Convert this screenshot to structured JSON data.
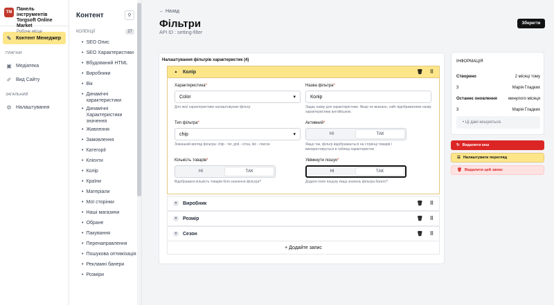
{
  "brand": {
    "logo_text": "TM",
    "title_line1": "Панель інструментів",
    "title_line2": "Torgsoft Online Market",
    "subtitle": "Робоче місце"
  },
  "nav": {
    "items": [
      {
        "label": "Контент Менеджер",
        "icon": "pencil-icon"
      }
    ],
    "plugins_title": "ПЛАГІНИ",
    "plugins": [
      {
        "label": "Медіатека",
        "icon": "image-icon"
      },
      {
        "label": "Вид Сайту",
        "icon": "brush-icon"
      }
    ],
    "general_title": "ЗАГАЛЬНИЙ",
    "general": [
      {
        "label": "Налаштування",
        "icon": "gear-icon"
      }
    ]
  },
  "collections": {
    "title": "Контент",
    "group_label": "КОЛЕКЦІЇ",
    "count": "27",
    "items": [
      "SEO Опис",
      "SEO Характеристики",
      "Вбудований HTML",
      "Виробники",
      "Вік",
      "Динамічні характеристики",
      "Динамічні Характеристики значення",
      "Живлення",
      "Замовлення",
      "Категорії",
      "Клієнти",
      "Колір",
      "Країни",
      "Матеріали",
      "Мої сторінки",
      "Наші магазини",
      "Обране",
      "Пакування",
      "Перенаправлення",
      "Пошукова оптимізація",
      "Рекламні банери",
      "Розміри"
    ]
  },
  "header": {
    "back": "← Назад",
    "title": "Фільтри",
    "api": "API ID : setting-filter",
    "save": "Зберегти"
  },
  "panel": {
    "label": "Налаштування фільтрів характеристик (4)",
    "open_item": "Колір",
    "items": [
      "Виробник",
      "Розмір",
      "Сезон"
    ],
    "add": "+ Додайте запис",
    "fields": {
      "char_label": "Характеристика",
      "char_value": "Color",
      "char_hint": "Для якої характеристики налаштовуємо фільтр",
      "name_label": "Назва фільтра",
      "name_value": "Колір",
      "name_hint": "Задає назву для характеристики. Якщо не вказано, сайт відображатиме назву характеристики англійською.",
      "type_label": "Тип фільтра",
      "type_value": "chip",
      "type_hint": "Зовнішній вигляд фільтра: chip - тег, grid - сітка, list - список",
      "active_label": "Активний",
      "active_no": "НІ",
      "active_yes": "ТАК",
      "active_hint": "Якщо так, фільтр відображається на сторінці товарів і використовується в таблиці характеристик",
      "count_label": "Кількість товарів",
      "count_no": "НІ",
      "count_yes": "ТАК",
      "count_hint": "Відображати кількість товарів біля значення фільтра?",
      "search_label": "Увімкнути пошук",
      "search_no": "НІ",
      "search_yes": "ТАК",
      "search_hint": "Додати поле пошуку якщо значень фільтра багато?"
    }
  },
  "info": {
    "title": "ІНФОРМАЦІЯ",
    "created_label": "Створено",
    "created_value": "2 місяці тому",
    "created_by_num": "3",
    "created_by": "Марія Гладких",
    "updated_label": "Останнє оновлення",
    "updated_value": "минулого місяця",
    "updated_by_num": "3",
    "updated_by": "Марія Гладких",
    "cache_note": "• Ці дані кешуються."
  },
  "actions": {
    "delete_cache": "Видалити кеш",
    "configure": "Налаштувати перегляд",
    "delete_entry": "Видалити цей запис"
  }
}
